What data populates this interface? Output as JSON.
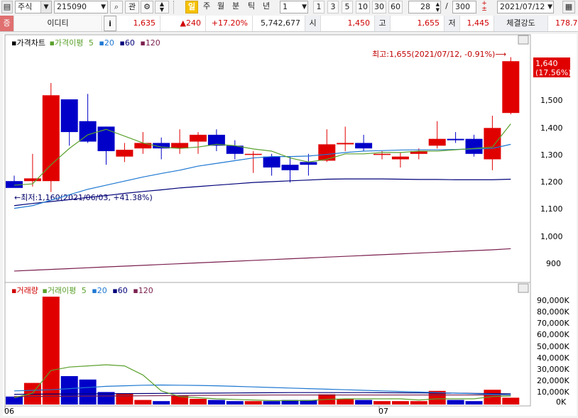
{
  "toolbar": {
    "market": "주식",
    "code": "215090",
    "search_label": "관",
    "day_label": "일",
    "period_tabs": [
      "주",
      "월",
      "분",
      "틱",
      "년"
    ],
    "unit_value": "1",
    "interval_buttons": [
      "1",
      "3",
      "5",
      "10",
      "30",
      "60"
    ],
    "count_value": "28",
    "slash": "/",
    "max_count": "300",
    "date": "2021/07/12"
  },
  "info": {
    "badge": "증",
    "stock_name": "이디티",
    "info_button": "i",
    "price": "1,635",
    "change": "▲240",
    "change_pct": "+17.20%",
    "volume": "5,742,677",
    "open_label": "시",
    "open": "1,450",
    "high_label": "고",
    "high": "1,655",
    "low_label": "저",
    "low": "1,445",
    "strength_label": "체결강도",
    "strength": "178.7"
  },
  "price_panel": {
    "title": "가격차트",
    "ma_title": "가격이평",
    "ma_periods": [
      "5",
      "20",
      "60",
      "120"
    ],
    "y_ticks": [
      "1,500",
      "1,400",
      "1,300",
      "1,200",
      "1,100",
      "1,000",
      "900"
    ],
    "current_value": "1,640",
    "current_pct": "(17.56%)",
    "high_note": "최고:1,655(2021/07/12, -0.91%)",
    "low_note": "최저:1,160(2021/06/03, +41.38%)"
  },
  "volume_panel": {
    "title": "거래량",
    "ma_title": "거래이평",
    "ma_periods": [
      "5",
      "20",
      "60",
      "120"
    ],
    "y_ticks": [
      "90,000K",
      "80,000K",
      "70,000K",
      "60,000K",
      "50,000K",
      "40,000K",
      "30,000K",
      "20,000K",
      "10,000K",
      "0K"
    ]
  },
  "x_labels": [
    "06",
    "07"
  ],
  "colors": {
    "up": "#e00000",
    "down": "#0000c8",
    "ma5": "#5aa02c",
    "ma20": "#1e78d2",
    "ma60": "#00007a",
    "ma120": "#7a1f4e"
  },
  "chart_data": {
    "type": "candlestick",
    "candles": [
      {
        "o": 1200,
        "h": 1220,
        "l": 1180,
        "c": 1175
      },
      {
        "o": 1200,
        "h": 1300,
        "l": 1180,
        "c": 1210
      },
      {
        "o": 1200,
        "h": 1560,
        "l": 1160,
        "c": 1515
      },
      {
        "o": 1500,
        "h": 1500,
        "l": 1330,
        "c": 1380
      },
      {
        "o": 1420,
        "h": 1520,
        "l": 1340,
        "c": 1345
      },
      {
        "o": 1400,
        "h": 1400,
        "l": 1260,
        "c": 1310
      },
      {
        "o": 1290,
        "h": 1340,
        "l": 1270,
        "c": 1315
      },
      {
        "o": 1320,
        "h": 1380,
        "l": 1300,
        "c": 1340
      },
      {
        "o": 1340,
        "h": 1360,
        "l": 1280,
        "c": 1320
      },
      {
        "o": 1320,
        "h": 1390,
        "l": 1300,
        "c": 1340
      },
      {
        "o": 1345,
        "h": 1380,
        "l": 1300,
        "c": 1370
      },
      {
        "o": 1370,
        "h": 1390,
        "l": 1310,
        "c": 1330
      },
      {
        "o": 1330,
        "h": 1350,
        "l": 1280,
        "c": 1300
      },
      {
        "o": 1300,
        "h": 1310,
        "l": 1230,
        "c": 1300
      },
      {
        "o": 1290,
        "h": 1300,
        "l": 1220,
        "c": 1250
      },
      {
        "o": 1260,
        "h": 1290,
        "l": 1195,
        "c": 1240
      },
      {
        "o": 1270,
        "h": 1300,
        "l": 1220,
        "c": 1260
      },
      {
        "o": 1275,
        "h": 1390,
        "l": 1270,
        "c": 1335
      },
      {
        "o": 1335,
        "h": 1400,
        "l": 1310,
        "c": 1340
      },
      {
        "o": 1340,
        "h": 1370,
        "l": 1310,
        "c": 1320
      },
      {
        "o": 1300,
        "h": 1310,
        "l": 1280,
        "c": 1300
      },
      {
        "o": 1280,
        "h": 1305,
        "l": 1250,
        "c": 1290
      },
      {
        "o": 1300,
        "h": 1320,
        "l": 1280,
        "c": 1310
      },
      {
        "o": 1330,
        "h": 1420,
        "l": 1320,
        "c": 1355
      },
      {
        "o": 1355,
        "h": 1380,
        "l": 1340,
        "c": 1350
      },
      {
        "o": 1355,
        "h": 1370,
        "l": 1290,
        "c": 1300
      },
      {
        "o": 1280,
        "h": 1440,
        "l": 1240,
        "c": 1395
      },
      {
        "o": 1450,
        "h": 1655,
        "l": 1445,
        "c": 1640
      }
    ],
    "ma5": [
      1185,
      1190,
      1260,
      1320,
      1370,
      1390,
      1365,
      1340,
      1325,
      1320,
      1325,
      1335,
      1330,
      1318,
      1310,
      1285,
      1270,
      1280,
      1300,
      1300,
      1305,
      1305,
      1310,
      1310,
      1315,
      1320,
      1325,
      1410
    ],
    "ma20": [
      1100,
      1110,
      1130,
      1150,
      1170,
      1185,
      1200,
      1215,
      1228,
      1240,
      1255,
      1265,
      1275,
      1285,
      1290,
      1290,
      1292,
      1298,
      1305,
      1310,
      1312,
      1314,
      1315,
      1315,
      1316,
      1318,
      1320,
      1335
    ],
    "ma60": [
      1110,
      1118,
      1125,
      1132,
      1140,
      1147,
      1155,
      1162,
      1168,
      1175,
      1180,
      1185,
      1190,
      1195,
      1198,
      1201,
      1204,
      1207,
      1208,
      1208,
      1208,
      1207,
      1206,
      1206,
      1205,
      1205,
      1205,
      1207
    ],
    "ma120": [
      870,
      873,
      876,
      879,
      882,
      885,
      888,
      891,
      894,
      897,
      900,
      903,
      906,
      909,
      912,
      915,
      918,
      921,
      924,
      927,
      930,
      933,
      936,
      939,
      942,
      945,
      948,
      952
    ],
    "volume": [
      7000,
      19000,
      95000,
      25000,
      22000,
      11000,
      10000,
      4000,
      3000,
      8000,
      5000,
      4000,
      3000,
      3000,
      3000,
      4000,
      4000,
      9000,
      5000,
      4000,
      3000,
      3000,
      3000,
      12000,
      4000,
      3000,
      13000,
      6000
    ],
    "vol_ma5": [
      6000,
      10000,
      30000,
      33000,
      34000,
      35000,
      34000,
      26000,
      12000,
      7000,
      6000,
      5000,
      4500,
      4000,
      3500,
      3500,
      3500,
      4500,
      5000,
      5000,
      5000,
      5000,
      4000,
      5000,
      5000,
      5000,
      7000,
      7500
    ],
    "vol_ma20": [
      12000,
      12500,
      13000,
      14000,
      15000,
      16000,
      16500,
      17000,
      17200,
      17000,
      16800,
      16500,
      16000,
      15500,
      15000,
      14500,
      14000,
      13500,
      13000,
      12500,
      12000,
      11500,
      11000,
      10500,
      10000,
      9500,
      9000,
      8500
    ],
    "vol_ma60": [
      9000,
      9100,
      9200,
      9300,
      9400,
      9500,
      9600,
      9700,
      9800,
      9900,
      10000,
      10100,
      10200,
      10300,
      10400,
      10500,
      10500,
      10500,
      10500,
      10500,
      10400,
      10300,
      10200,
      10100,
      10000,
      9800,
      9600,
      9500
    ],
    "vol_ma120": [
      7000,
      7100,
      7200,
      7300,
      7400,
      7500,
      7600,
      7700,
      7800,
      7900,
      8000,
      8100,
      8200,
      8300,
      8400,
      8400,
      8400,
      8400,
      8400,
      8400,
      8400,
      8400,
      8400,
      8400,
      8400,
      8400,
      8400,
      8400
    ]
  }
}
